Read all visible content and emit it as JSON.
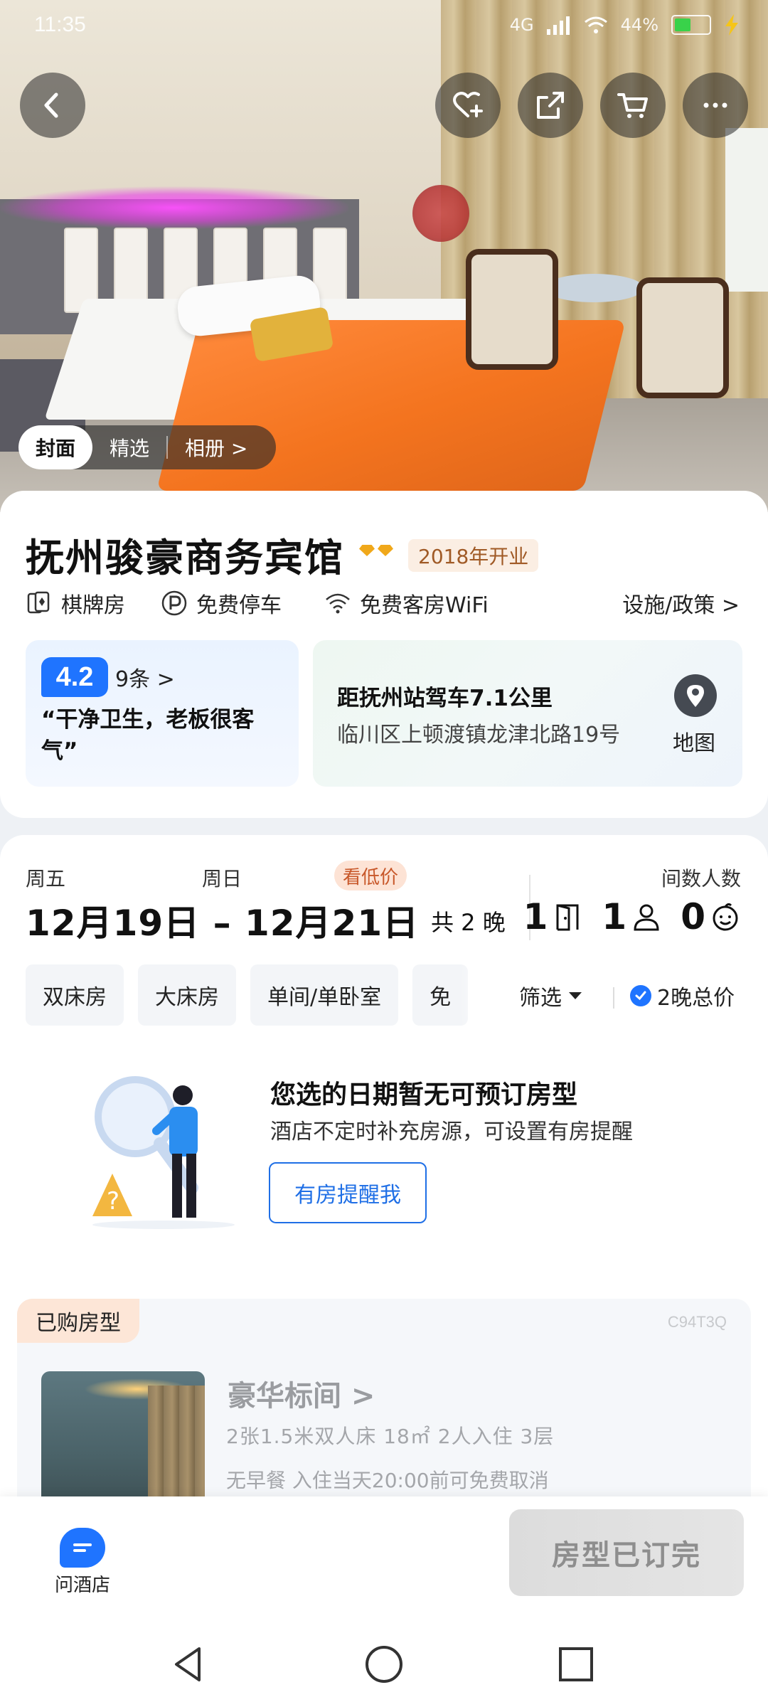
{
  "status_bar": {
    "time": "11:35",
    "network": "4G",
    "battery": "44%"
  },
  "photo_tabs": {
    "cover": "封面",
    "featured": "精选",
    "album": "相册 >"
  },
  "hotel": {
    "name": "抚州骏豪商务宾馆",
    "opened": "2018年开业",
    "facilities": [
      "棋牌房",
      "免费停车",
      "免费客房WiFi"
    ],
    "policy_link": "设施/政策 >",
    "rating": "4.2",
    "review_count": "9条 >",
    "review_quote": "“干净卫生，老板很客气”",
    "distance": "距抚州站驾车7.1公里",
    "address": "临川区上顿渡镇龙津北路19号",
    "map_label": "地图"
  },
  "booking": {
    "checkin_day": "周五",
    "checkout_day": "周日",
    "low_price_tag": "看低价",
    "dates": "12月19日 – 12月21日",
    "nights": "共 2 晚",
    "guests_label": "间数人数",
    "rooms": "1",
    "adults": "1",
    "children": "0"
  },
  "filters": {
    "chips": [
      "双床房",
      "大床房",
      "单间/单卧室",
      "免"
    ],
    "screen": "筛选",
    "total_price": "2晚总价"
  },
  "empty_state": {
    "title": "您选的日期暂无可预订房型",
    "subtitle": "酒店不定时补充房源，可设置有房提醒",
    "button": "有房提醒我"
  },
  "purchased": {
    "tag": "已购房型",
    "code": "C94T3Q",
    "room_name": "豪华标间 >",
    "spec": "2张1.5米双人床   18㎡   2人入住   3层",
    "policy": "无早餐   入住当天20:00前可免费取消"
  },
  "bottom": {
    "ask": "问酒店",
    "soldout": "房型已订完"
  },
  "colors": {
    "accent": "#1f74ff",
    "orange_tag": "#fbeee3",
    "soldout_bg": "#dcdcdc"
  }
}
